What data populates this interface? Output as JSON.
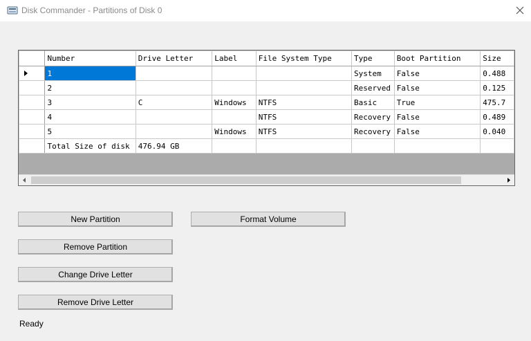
{
  "window": {
    "title": "Disk Commander - Partitions of Disk 0",
    "icon": "disk-icon",
    "close_icon": "close-icon"
  },
  "grid": {
    "columns": [
      "Number",
      "Drive Letter",
      "Label",
      "File System Type",
      "Type",
      "Boot Partition",
      "Size"
    ],
    "rows": [
      [
        "1",
        "",
        "",
        "",
        "System",
        "False",
        "0.488"
      ],
      [
        "2",
        "",
        "",
        "",
        "Reserved",
        "False",
        "0.125"
      ],
      [
        "3",
        "C",
        "Windows",
        "NTFS",
        "Basic",
        "True",
        "475.7"
      ],
      [
        "4",
        "",
        "",
        "NTFS",
        "Recovery",
        "False",
        "0.489"
      ],
      [
        "5",
        "",
        "Windows",
        "NTFS",
        "Recovery",
        "False",
        "0.040"
      ],
      [
        "Total Size of disk",
        "476.94 GB",
        "",
        "",
        "",
        "",
        ""
      ]
    ],
    "selected_row": 0,
    "selected_col": 0
  },
  "buttons": {
    "new_partition": "New Partition",
    "format_volume": "Format Volume",
    "remove_partition": "Remove Partition",
    "change_drive_letter": "Change Drive Letter",
    "remove_drive_letter": "Remove Drive Letter"
  },
  "status": "Ready"
}
